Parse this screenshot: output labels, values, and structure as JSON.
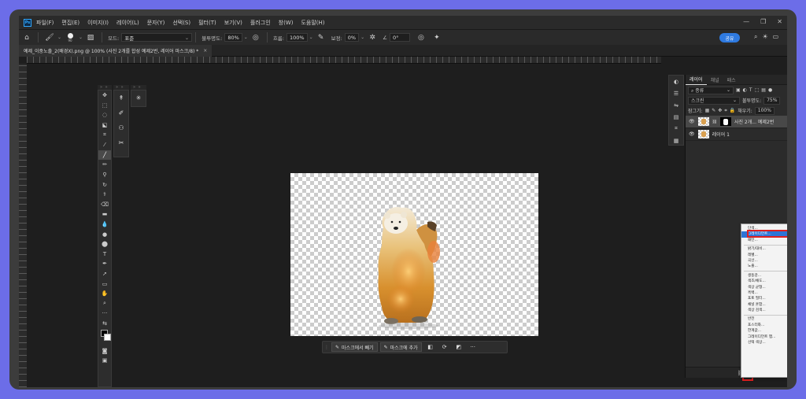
{
  "app": {
    "logo": "Ps",
    "menu": [
      "파일(F)",
      "편집(E)",
      "이미지(I)",
      "레이어(L)",
      "문자(Y)",
      "선택(S)",
      "필터(T)",
      "보기(V)",
      "플러그인",
      "창(W)",
      "도움말(H)"
    ],
    "window_controls": [
      "—",
      "❐",
      "✕"
    ]
  },
  "options": {
    "brush_size": "90",
    "mode_label": "모드:",
    "mode_value": "표준",
    "opacity_label": "불투명도:",
    "opacity_value": "80%",
    "flow_label": "흐름:",
    "flow_value": "100%",
    "smoothing_label": "보정:",
    "smoothing_value": "0%",
    "angle_label": "∠",
    "angle_value": "0°",
    "share_label": "공유"
  },
  "document": {
    "tab_title": "예제_이중노출_2(배경X).png @ 100% (사진 2개를 합성 예제2번, 레이어 마스크/8) *",
    "tab_close": "×"
  },
  "context_bar": {
    "subtract_label": "마스크에서 빼기",
    "add_label": "마스크에 추가",
    "more": "···"
  },
  "layers_panel": {
    "tabs": [
      "레이어",
      "채널",
      "패스"
    ],
    "filter_value": "종류",
    "blend_mode": "스크린",
    "opacity_label": "불투명도:",
    "opacity_value": "75%",
    "lock_label": "잠그기:",
    "fill_label": "채우기:",
    "fill_value": "100%",
    "layers": [
      {
        "name": "사진 2개... 예제2번",
        "selected": true
      },
      {
        "name": "레이어 1",
        "selected": false
      }
    ],
    "bottom_icons": [
      "link-icon",
      "fx-icon",
      "mask-icon",
      "adjustment-icon"
    ],
    "bottom_fx": "fx"
  },
  "adjustment_menu": {
    "items": [
      {
        "label": "단색...",
        "highlight": false
      },
      {
        "label": "그레이디언트...",
        "highlight": true
      },
      {
        "label": "패턴...",
        "highlight": false
      },
      {
        "sep": true
      },
      {
        "label": "밝기/대비...",
        "highlight": false
      },
      {
        "label": "레벨...",
        "highlight": false
      },
      {
        "label": "곡선...",
        "highlight": false
      },
      {
        "label": "노출...",
        "highlight": false
      },
      {
        "sep": true
      },
      {
        "label": "생동감...",
        "highlight": false
      },
      {
        "label": "색조/채도...",
        "highlight": false
      },
      {
        "label": "색상 균형...",
        "highlight": false
      },
      {
        "label": "흑백...",
        "highlight": false
      },
      {
        "label": "포토 필터...",
        "highlight": false
      },
      {
        "label": "채널 혼합...",
        "highlight": false
      },
      {
        "label": "색상 검색...",
        "highlight": false
      },
      {
        "sep": true
      },
      {
        "label": "반전",
        "highlight": false
      },
      {
        "label": "포스터화...",
        "highlight": false
      },
      {
        "label": "한계값...",
        "highlight": false
      },
      {
        "label": "그레이디언트 맵...",
        "highlight": false
      },
      {
        "label": "선택 색상...",
        "highlight": false
      }
    ]
  },
  "colors": {
    "accent": "#2f7ae0",
    "highlight_box": "#e02020",
    "background": "#6c6de8"
  }
}
